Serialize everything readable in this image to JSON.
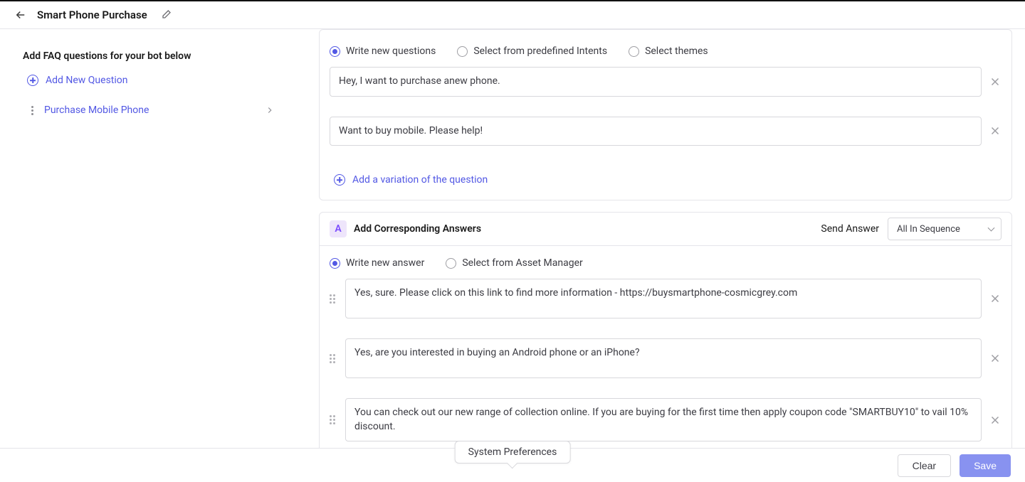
{
  "header": {
    "title": "Smart Phone Purchase"
  },
  "sidebar": {
    "heading": "Add FAQ questions for your bot below",
    "add_new_label": "Add New Question",
    "items": [
      {
        "label": "Purchase Mobile Phone"
      }
    ]
  },
  "questions_card": {
    "radio_options": {
      "write_new": "Write new questions",
      "predefined": "Select from predefined Intents",
      "themes": "Select themes"
    },
    "inputs": [
      "Hey, I want to purchase anew phone.",
      "Want to buy mobile. Please help!"
    ],
    "add_variation_label": "Add a variation of the question"
  },
  "answers_card": {
    "badge_letter": "A",
    "section_title": "Add Corresponding Answers",
    "send_answer_label": "Send Answer",
    "send_answer_selected": "All In Sequence",
    "radio_options": {
      "write_new": "Write new answer",
      "asset_manager": "Select from Asset Manager"
    },
    "inputs": [
      "Yes, sure. Please click on this link to find more information - https://buysmartphone-cosmicgrey.com",
      "Yes, are you interested in buying an Android phone or an iPhone?",
      "You can check out our new range of collection online. If you are buying for the first time then apply coupon code \"SMARTBUY10\" to vail 10% discount."
    ]
  },
  "footer": {
    "clear_label": "Clear",
    "save_label": "Save"
  },
  "tooltip": "System Preferences"
}
